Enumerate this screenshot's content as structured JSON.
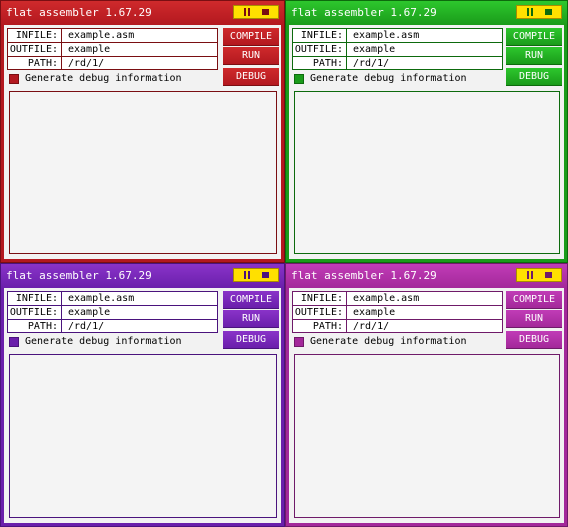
{
  "app_title": "flat assembler 1.67.29",
  "fields": {
    "infile_label": "INFILE:",
    "infile_value": "example.asm",
    "outfile_label": "OUTFILE:",
    "outfile_value": "example",
    "path_label": "PATH:",
    "path_value": "/rd/1/"
  },
  "buttons": {
    "compile": "COMPILE",
    "run": "RUN",
    "debug": "DEBUG"
  },
  "debug_option": {
    "label": "Generate debug information",
    "checked": true
  },
  "themes": [
    {
      "name": "red",
      "accent": "#b3181f",
      "light": "#cf2a2c",
      "dark": "#7a0e12"
    },
    {
      "name": "green",
      "accent": "#1a9b1a",
      "light": "#2dc72d",
      "dark": "#0d6a0d"
    },
    {
      "name": "purple",
      "accent": "#6a1fab",
      "light": "#8a33c9",
      "dark": "#4a137d"
    },
    {
      "name": "magenta",
      "accent": "#a3289a",
      "light": "#c13cb7",
      "dark": "#6f1a69"
    }
  ]
}
